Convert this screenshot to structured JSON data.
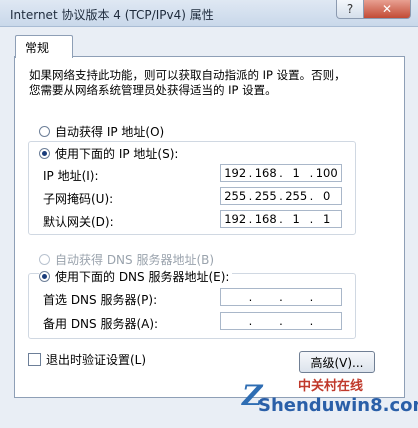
{
  "window": {
    "title": "Internet 协议版本 4 (TCP/IPv4) 属性",
    "help_label": "?",
    "close_label": "✕"
  },
  "tabs": [
    {
      "label": "常规"
    }
  ],
  "description": {
    "line1": "如果网络支持此功能，则可以获取自动指派的 IP 设置。否则，",
    "line2": "您需要从网络系统管理员处获得适当的 IP 设置。"
  },
  "ip": {
    "auto_label": "自动获得 IP 地址(O)",
    "manual_label": "使用下面的 IP 地址(S):",
    "selected": "manual",
    "address_label": "IP 地址(I):",
    "address": [
      "192",
      "168",
      "1",
      "100"
    ],
    "mask_label": "子网掩码(U):",
    "mask": [
      "255",
      "255",
      "255",
      "0"
    ],
    "gateway_label": "默认网关(D):",
    "gateway": [
      "192",
      "168",
      "1",
      "1"
    ]
  },
  "dns": {
    "auto_label": "自动获得 DNS 服务器地址(B)",
    "manual_label": "使用下面的 DNS 服务器地址(E):",
    "selected": "manual",
    "preferred_label": "首选 DNS 服务器(P):",
    "preferred": [
      "",
      "",
      "",
      ""
    ],
    "alternate_label": "备用 DNS 服务器(A):",
    "alternate": [
      "",
      "",
      "",
      ""
    ]
  },
  "validate": {
    "label": "退出时验证设置(L)",
    "checked": false
  },
  "advanced_button": "高级(V)...",
  "watermark": {
    "logo": "Z",
    "cn": "中关村在线",
    "en": "Shenduwin8.com"
  }
}
